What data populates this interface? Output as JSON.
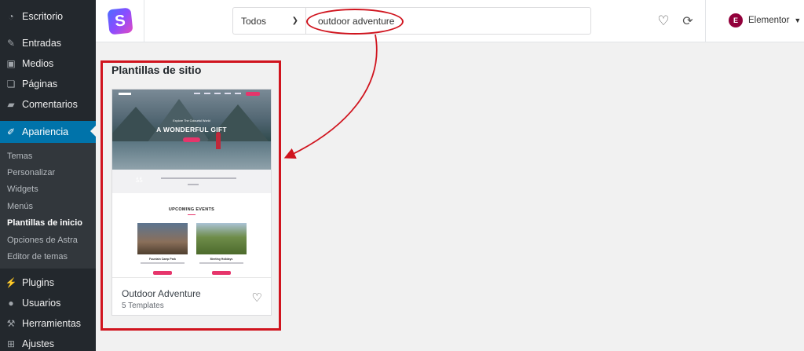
{
  "sidebar": {
    "top_items": [
      {
        "label": "Escritorio",
        "icon": "dashboard-icon"
      },
      {
        "label": "Entradas",
        "icon": "pin-icon"
      },
      {
        "label": "Medios",
        "icon": "media-icon"
      },
      {
        "label": "Páginas",
        "icon": "page-icon"
      },
      {
        "label": "Comentarios",
        "icon": "comment-icon"
      }
    ],
    "active_item": {
      "label": "Apariencia",
      "icon": "brush-icon"
    },
    "submenu": [
      "Temas",
      "Personalizar",
      "Widgets",
      "Menús",
      "Plantillas de inicio",
      "Opciones de Astra",
      "Editor de temas"
    ],
    "submenu_current": "Plantillas de inicio",
    "bottom_items": [
      {
        "label": "Plugins",
        "icon": "plug-icon"
      },
      {
        "label": "Usuarios",
        "icon": "user-icon"
      },
      {
        "label": "Herramientas",
        "icon": "wrench-icon"
      },
      {
        "label": "Ajustes",
        "icon": "settings-icon"
      }
    ]
  },
  "topbar": {
    "logo_letter": "S",
    "category_select": "Todos",
    "search_value": "outdoor adventure",
    "builder_label": "Elementor",
    "builder_icon_letter": "E"
  },
  "section": {
    "title": "Plantillas de sitio"
  },
  "template_card": {
    "name": "Outdoor Adventure",
    "count": "5 Templates",
    "preview": {
      "hero_subtitle": "Explore The Colourful World",
      "hero_title": "A WONDERFUL GIFT",
      "events_title": "UPCOMING EVENTS",
      "event_1_caption": "Fountain Camp Park",
      "event_2_caption": "Meeting Holidays"
    }
  },
  "colors": {
    "sidebar_bg": "#23282d",
    "active_blue": "#0073aa",
    "annotation_red": "#d0141e",
    "accent_pink": "#e6356b"
  }
}
